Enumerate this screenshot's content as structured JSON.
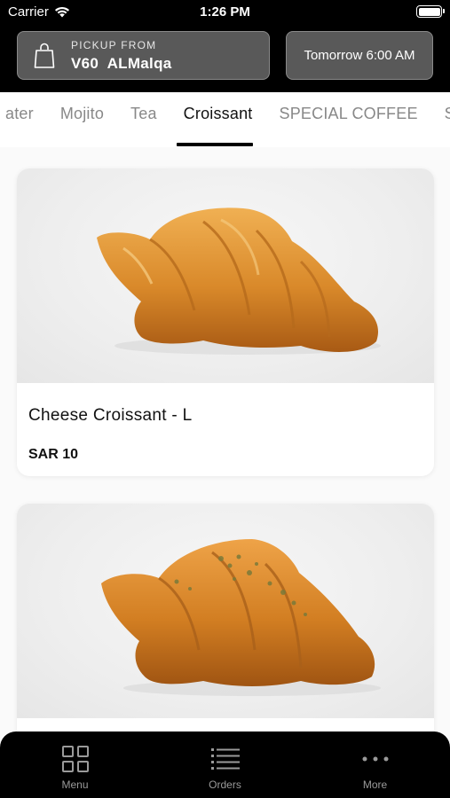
{
  "status_bar": {
    "carrier": "Carrier",
    "time": "1:26 PM"
  },
  "header": {
    "pickup_label": "PICKUP FROM",
    "pickup_store": "V60  ALMalqa",
    "pickup_time": "Tomorrow 6:00 AM"
  },
  "tabs": [
    {
      "label": "ater"
    },
    {
      "label": "Mojito"
    },
    {
      "label": "Tea"
    },
    {
      "label": "Croissant",
      "active": true
    },
    {
      "label": "SPECIAL COFFEE"
    },
    {
      "label": "Sa"
    }
  ],
  "products": [
    {
      "name": "Cheese Croissant - L",
      "price": "SAR 10"
    },
    {
      "name": "",
      "price": ""
    }
  ],
  "bottom_nav": {
    "menu_label": "Menu",
    "orders_label": "Orders",
    "more_label": "More"
  },
  "colors": {
    "header_bg": "#000000",
    "pill_bg": "#595959",
    "tab_active": "#111111",
    "tab_inactive": "#888888"
  }
}
